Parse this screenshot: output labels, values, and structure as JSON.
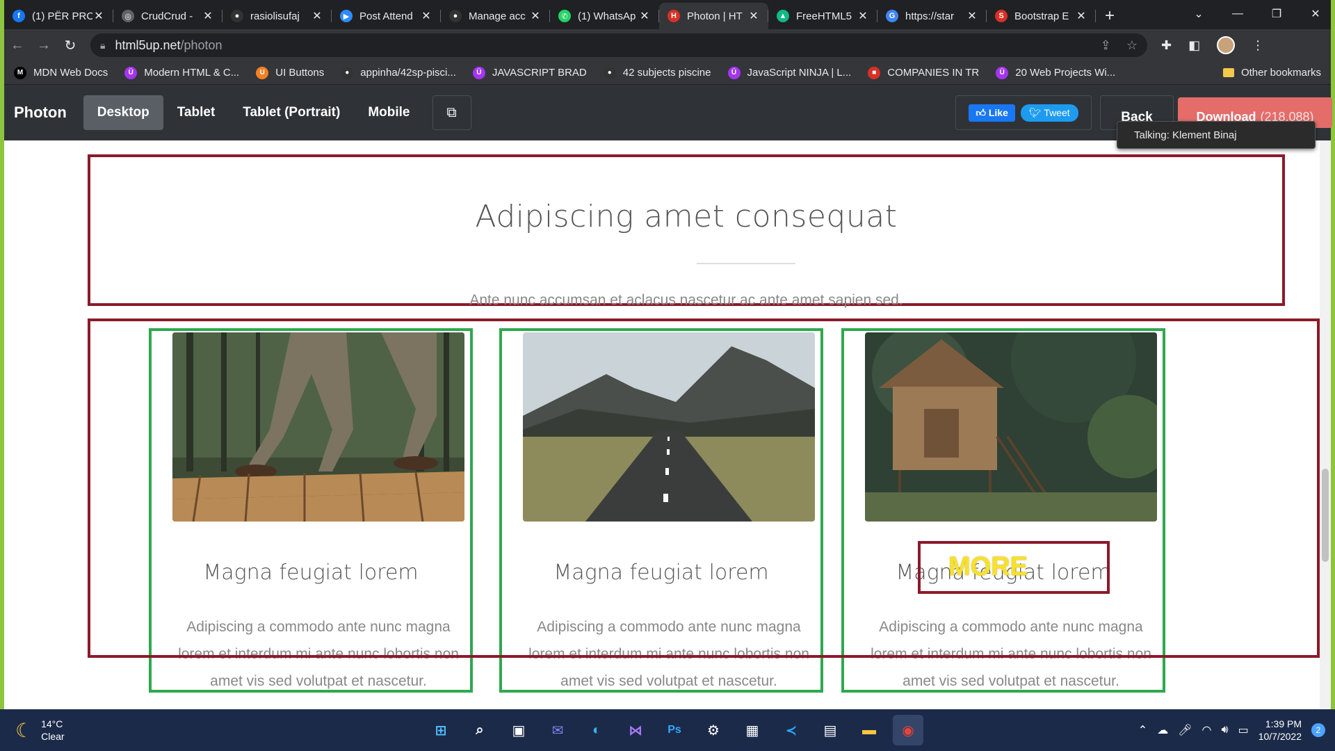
{
  "browser": {
    "tabs": [
      {
        "label": "(1) PËR PRO",
        "color": "#1877f2",
        "glyph": "f"
      },
      {
        "label": "CrudCrud -",
        "color": "#5f6368",
        "glyph": "◎"
      },
      {
        "label": "rasiolisufaj",
        "color": "#333333",
        "glyph": "●"
      },
      {
        "label": "Post Attend",
        "color": "#2d8cff",
        "glyph": "▶"
      },
      {
        "label": "Manage acc",
        "color": "#333333",
        "glyph": "●"
      },
      {
        "label": "(1) WhatsAp",
        "color": "#25d366",
        "glyph": "✆"
      },
      {
        "label": "Photon | HT",
        "color": "#d93025",
        "glyph": "H"
      },
      {
        "label": "FreeHTML5",
        "color": "#12b886",
        "glyph": "▲"
      },
      {
        "label": "https://star",
        "color": "#4285f4",
        "glyph": "G"
      },
      {
        "label": "Bootstrap E",
        "color": "#d93025",
        "glyph": "S"
      }
    ],
    "active_tab_index": 6,
    "url_host": "html5up.net",
    "url_path": "/photon",
    "bookmarks": [
      {
        "label": "MDN Web Docs",
        "color": "#000000",
        "glyph": "M"
      },
      {
        "label": "Modern HTML & C...",
        "color": "#a435f0",
        "glyph": "Ü"
      },
      {
        "label": "UI Buttons",
        "color": "#f48024",
        "glyph": "U"
      },
      {
        "label": "appinha/42sp-pisci...",
        "color": "#333333",
        "glyph": "●"
      },
      {
        "label": "JAVASCRIPT BRAD",
        "color": "#a435f0",
        "glyph": "Ü"
      },
      {
        "label": "42 subjects piscine",
        "color": "#333333",
        "glyph": "●"
      },
      {
        "label": "JavaScript NINJA | L...",
        "color": "#a435f0",
        "glyph": "Ü"
      },
      {
        "label": "COMPANIES IN TR",
        "color": "#d93025",
        "glyph": "■"
      },
      {
        "label": "20 Web Projects Wi...",
        "color": "#a435f0",
        "glyph": "Ü"
      }
    ],
    "other_bookmarks": "Other bookmarks"
  },
  "preview": {
    "brand": "Photon",
    "views": [
      "Desktop",
      "Tablet",
      "Tablet (Portrait)",
      "Mobile"
    ],
    "active_view_index": 0,
    "like_label": "Like",
    "tweet_label": "Tweet",
    "back_label": "Back",
    "download_label": "Download",
    "download_size": "(218,088)",
    "tooltip": "Talking: Klement Binaj"
  },
  "hero": {
    "title": "Adipiscing amet consequat",
    "subtitle": "Ante nunc accumsan et aclacus nascetur ac ante amet sapien sed."
  },
  "cards": [
    {
      "title": "Magna feugiat lorem",
      "text": "Adipiscing a commodo ante nunc magna lorem et interdum mi ante nunc lobortis non amet vis sed volutpat et nascetur.",
      "image": "hiker-on-boardwalk"
    },
    {
      "title": "Magna feugiat lorem",
      "text": "Adipiscing a commodo ante nunc magna lorem et interdum mi ante nunc lobortis non amet vis sed volutpat et nascetur.",
      "image": "mountain-road"
    },
    {
      "title": "Magna feugiat lorem",
      "text": "Adipiscing a commodo ante nunc magna lorem et interdum mi ante nunc lobortis non amet vis sed volutpat et nascetur.",
      "image": "wooden-hut-in-forest"
    }
  ],
  "annotation": {
    "more_label": "MORE"
  },
  "taskbar": {
    "temperature": "14°C",
    "condition": "Clear",
    "time": "1:39 PM",
    "date": "10/7/2022",
    "notifications": "2"
  }
}
